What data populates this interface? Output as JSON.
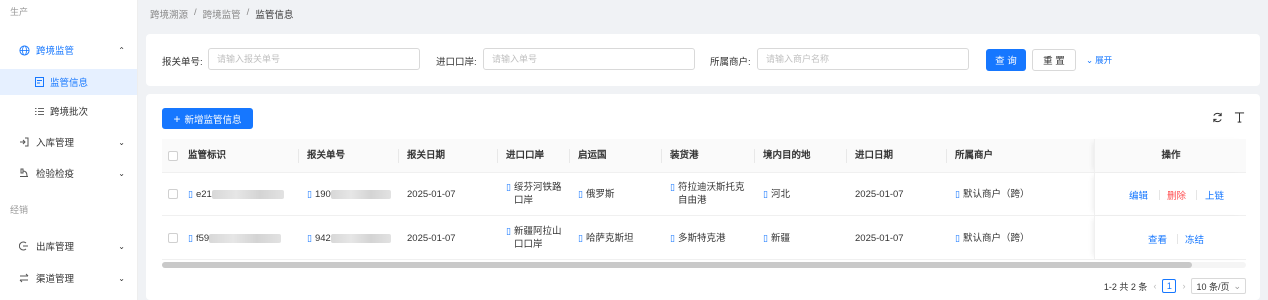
{
  "sidebar": {
    "group1": "生产",
    "cross_border": "跨境监管",
    "sub_info": "监管信息",
    "sub_batch": "跨境批次",
    "inbound": "入库管理",
    "inspection": "检验检疫",
    "group2": "经销",
    "outbound": "出库管理",
    "channel": "渠道管理"
  },
  "breadcrumb": {
    "items": [
      "跨境溯源",
      "跨境监管",
      "监管信息"
    ],
    "sep": "/"
  },
  "search": {
    "customs_label": "报关单号:",
    "customs_placeholder": "请输入报关单号",
    "port_label": "进口口岸:",
    "port_placeholder": "请输入单号",
    "merchant_label": "所属商户:",
    "merchant_placeholder": "请输入商户名称",
    "query_btn": "查 询",
    "reset_btn": "重 置",
    "expand": "展开"
  },
  "toolbar": {
    "new_btn": "新增监管信息"
  },
  "table": {
    "headers": [
      "监管标识",
      "报关单号",
      "报关日期",
      "进口口岸",
      "启运国",
      "装货港",
      "境内目的地",
      "进口日期",
      "所属商户",
      "操作"
    ],
    "rows": [
      {
        "id": "e21",
        "customs_no": "190",
        "customs_date": "2025-01-07",
        "port_line1": "绥芬河铁路",
        "port_line2": "口岸",
        "origin": "俄罗斯",
        "load_line1": "符拉迪沃斯托克",
        "load_line2": "自由港",
        "dest": "河北",
        "import_date": "2025-01-07",
        "merchant": "默认商户（跨）",
        "actions": [
          "编辑",
          "删除",
          "上链"
        ]
      },
      {
        "id": "f59",
        "customs_no": "942",
        "customs_date": "2025-01-07",
        "port_line1": "新疆阿拉山",
        "port_line2": "口口岸",
        "origin": "哈萨克斯坦",
        "load_line1": "多斯特克港",
        "load_line2": "",
        "dest": "新疆",
        "import_date": "2025-01-07",
        "merchant": "默认商户（跨）",
        "actions": [
          "查看",
          "冻结"
        ]
      }
    ]
  },
  "pagination": {
    "summary": "1-2 共 2 条",
    "current": "1",
    "page_size": "10 条/页"
  },
  "colors": {
    "primary": "#1677ff",
    "danger": "#ff4d4f"
  },
  "icons": [
    "globe-icon",
    "doc-icon",
    "list-icon",
    "login-icon",
    "inspect-icon",
    "logout-icon",
    "swap-icon",
    "refresh-icon",
    "column-height-icon",
    "plus-icon"
  ]
}
